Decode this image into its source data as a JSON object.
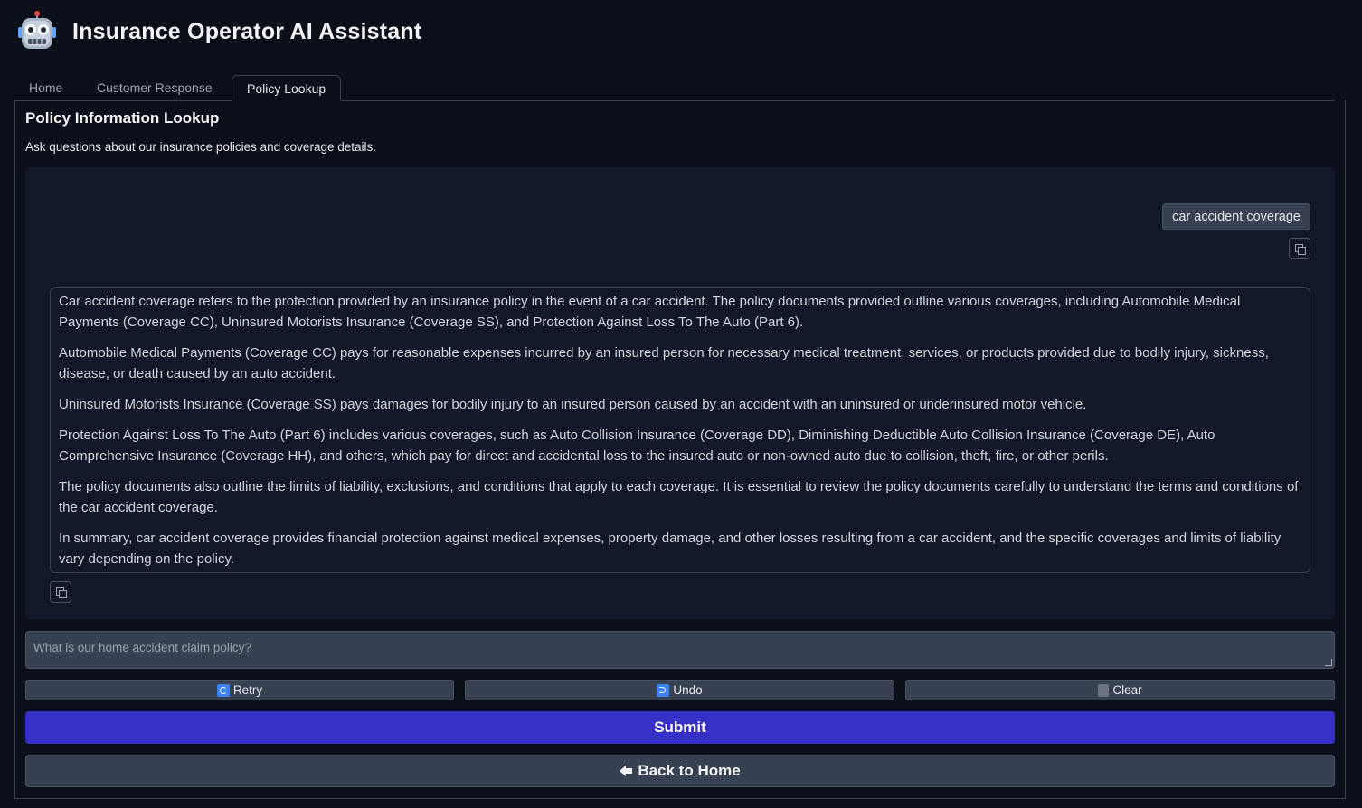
{
  "app": {
    "title": "Insurance Operator AI Assistant",
    "logo_icon": "robot-face-icon"
  },
  "tabs": [
    {
      "label": "Home",
      "active": false
    },
    {
      "label": "Customer Response",
      "active": false
    },
    {
      "label": "Policy Lookup",
      "active": true
    }
  ],
  "panel": {
    "title": "Policy Information Lookup",
    "description": "Ask questions about our insurance policies and coverage details."
  },
  "chat": {
    "user_message": "car accident coverage",
    "bot_paragraphs": [
      "Car accident coverage refers to the protection provided by an insurance policy in the event of a car accident. The policy documents provided outline various coverages, including Automobile Medical Payments (Coverage CC), Uninsured Motorists Insurance (Coverage SS), and Protection Against Loss To The Auto (Part 6).",
      "Automobile Medical Payments (Coverage CC) pays for reasonable expenses incurred by an insured person for necessary medical treatment, services, or products provided due to bodily injury, sickness, disease, or death caused by an auto accident.",
      "Uninsured Motorists Insurance (Coverage SS) pays damages for bodily injury to an insured person caused by an accident with an uninsured or underinsured motor vehicle.",
      "Protection Against Loss To The Auto (Part 6) includes various coverages, such as Auto Collision Insurance (Coverage DD), Diminishing Deductible Auto Collision Insurance (Coverage DE), Auto Comprehensive Insurance (Coverage HH), and others, which pay for direct and accidental loss to the insured auto or non-owned auto due to collision, theft, fire, or other perils.",
      "The policy documents also outline the limits of liability, exclusions, and conditions that apply to each coverage. It is essential to review the policy documents carefully to understand the terms and conditions of the car accident coverage.",
      "In summary, car accident coverage provides financial protection against medical expenses, property damage, and other losses resulting from a car accident, and the specific coverages and limits of liability vary depending on the policy."
    ]
  },
  "input": {
    "value": "",
    "placeholder": "What is our home accident claim policy?"
  },
  "buttons": {
    "retry": "Retry",
    "undo": "Undo",
    "clear": "Clear",
    "submit": "Submit",
    "back": "Back to Home"
  },
  "colors": {
    "background": "#0b0f19",
    "chat_background": "#111827",
    "submit_accent": "#3730c8",
    "secondary_button": "#374151"
  }
}
